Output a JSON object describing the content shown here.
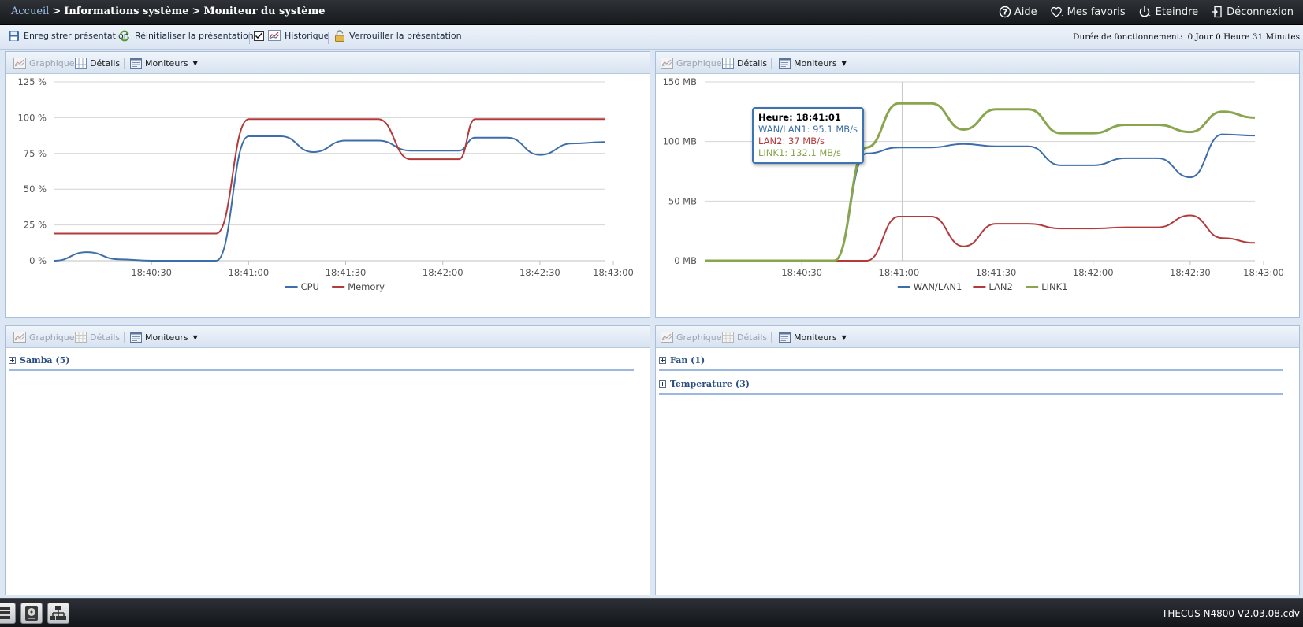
{
  "breadcrumb": {
    "home": "Accueil",
    "sep1": ">",
    "level1": "Informations système",
    "sep2": ">",
    "level2": "Moniteur du système"
  },
  "topmenu": {
    "help": "Aide",
    "favorites": "Mes favoris",
    "shutdown": "Eteindre",
    "logout": "Déconnexion"
  },
  "toolbar": {
    "save": "Enregistrer présentation",
    "reset": "Réinitialiser la présentation",
    "history": "Historique",
    "history_checked": true,
    "lock": "Verrouiller la présentation",
    "uptime_label": "Durée de fonctionnement:",
    "uptime_value": "0 Jour 0 Heure 31 Minutes"
  },
  "panels": [
    {
      "graph": "Graphique",
      "details": "Détails",
      "monitors": "Moniteurs"
    },
    {
      "graph": "Graphique",
      "details": "Détails",
      "monitors": "Moniteurs"
    },
    {
      "graph": "Graphique",
      "details": "Détails",
      "monitors": "Moniteurs",
      "tree": [
        {
          "label": "Samba (5)"
        }
      ]
    },
    {
      "graph": "Graphique",
      "details": "Détails",
      "monitors": "Moniteurs",
      "tree": [
        {
          "label": "Fan (1)"
        },
        {
          "label": "Temperature (3)"
        }
      ]
    }
  ],
  "tooltip": {
    "title": "Heure: 18:41:01",
    "lines": [
      {
        "text": "WAN/LAN1: 95.1 MB/s",
        "color": "#3d6eaa"
      },
      {
        "text": "LAN2: 37 MB/s",
        "color": "#b33a3a"
      },
      {
        "text": "LINK1: 132.1 MB/s",
        "color": "#89a54e"
      }
    ]
  },
  "footer": {
    "version": "THECUS N4800 V2.03.08.cdv"
  },
  "chart_data": [
    {
      "type": "line",
      "ylim": [
        0,
        125
      ],
      "yticks": [
        0,
        25,
        50,
        75,
        100,
        125
      ],
      "ytick_labels": [
        "0 %",
        "25 %",
        "50 %",
        "75 %",
        "100 %",
        "125 %"
      ],
      "xlim": [
        0,
        170
      ],
      "xticks": [
        30,
        60,
        90,
        120,
        150,
        180
      ],
      "xtick_labels": [
        "18:40:30",
        "18:41:00",
        "18:41:30",
        "18:42:00",
        "18:42:30",
        "18:43:00"
      ],
      "x": [
        0,
        10,
        20,
        30,
        40,
        45,
        50,
        60,
        70,
        80,
        90,
        95,
        100,
        110,
        120,
        125,
        130,
        140,
        150,
        160,
        170
      ],
      "grid": true,
      "legend": "bottom",
      "series": [
        {
          "name": "CPU",
          "color": "#3d6eaa",
          "values": [
            0,
            6,
            1,
            0,
            0,
            0,
            0,
            87,
            87,
            76,
            84,
            84,
            84,
            77,
            77,
            77,
            86,
            86,
            74,
            82,
            83
          ]
        },
        {
          "name": "Memory",
          "color": "#b33a3a",
          "values": [
            19,
            19,
            19,
            19,
            19,
            19,
            19,
            99,
            99,
            99,
            99,
            99,
            99,
            71,
            71,
            71,
            99,
            99,
            99,
            99,
            99
          ]
        }
      ]
    },
    {
      "type": "line",
      "ylim": [
        0,
        150
      ],
      "yticks": [
        0,
        50,
        100,
        150
      ],
      "ytick_labels": [
        "0 MB",
        "50 MB",
        "100 MB",
        "150 MB"
      ],
      "xlim": [
        0,
        170
      ],
      "xticks": [
        30,
        60,
        90,
        120,
        150,
        180
      ],
      "xtick_labels": [
        "18:40:30",
        "18:41:00",
        "18:41:30",
        "18:42:00",
        "18:42:30",
        "18:43:00"
      ],
      "x": [
        0,
        10,
        20,
        30,
        40,
        50,
        60,
        70,
        80,
        90,
        100,
        110,
        120,
        130,
        140,
        150,
        160,
        170
      ],
      "grid": true,
      "legend": "bottom",
      "crosshair_x": 61,
      "series": [
        {
          "name": "WAN/LAN1",
          "color": "#3d6eaa",
          "values": [
            0,
            0,
            0,
            0,
            0,
            90,
            95,
            95,
            98,
            96,
            96,
            80,
            80,
            86,
            86,
            70,
            106,
            105
          ]
        },
        {
          "name": "LAN2",
          "color": "#b33a3a",
          "values": [
            0,
            0,
            0,
            0,
            0,
            0,
            37,
            37,
            12,
            31,
            31,
            27,
            27,
            28,
            28,
            38,
            19,
            15
          ]
        },
        {
          "name": "LINK1",
          "color": "#89a54e",
          "values": [
            0,
            0,
            0,
            0,
            0,
            95,
            132,
            132,
            110,
            127,
            127,
            107,
            107,
            114,
            114,
            108,
            125,
            120
          ]
        }
      ]
    }
  ]
}
